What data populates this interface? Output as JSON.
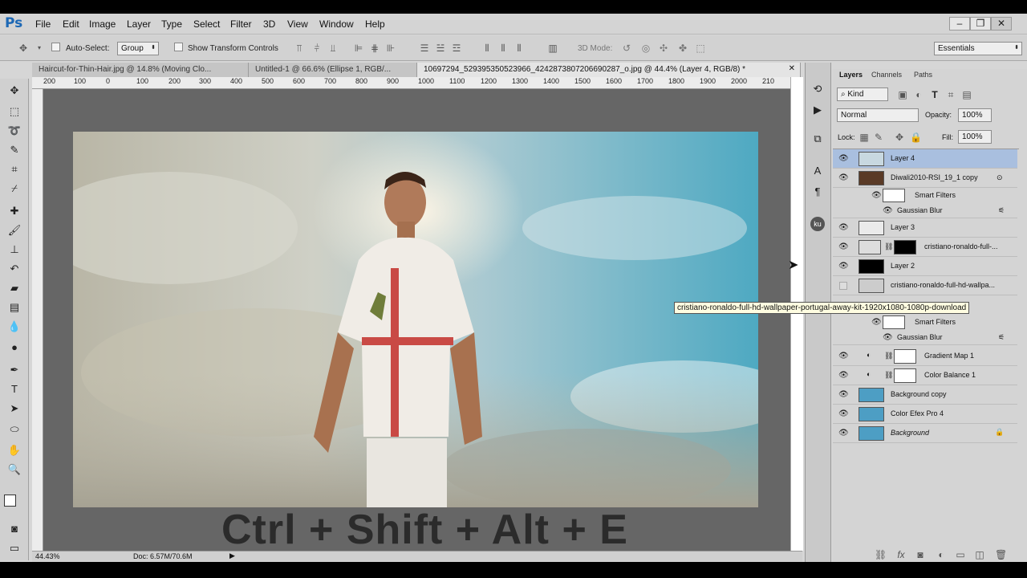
{
  "app": {
    "logo": "Ps"
  },
  "menu": [
    "File",
    "Edit",
    "Image",
    "Layer",
    "Type",
    "Select",
    "Filter",
    "3D",
    "View",
    "Window",
    "Help"
  ],
  "options": {
    "auto_select": "Auto-Select:",
    "auto_select_value": "Group",
    "show_transform": "Show Transform Controls",
    "mode_3d": "3D Mode:",
    "workspace": "Essentials"
  },
  "tabs": [
    "Haircut-for-Thin-Hair.jpg @ 14.8% (Moving Clo...",
    "Untitled-1 @ 66.6% (Ellipse 1, RGB/...",
    "10697294_529395350523966_4242873807206690287_o.jpg @ 44.4% (Layer 4, RGB/8) *"
  ],
  "ruler": [
    "200",
    "100",
    "0",
    "100",
    "200",
    "300",
    "400",
    "500",
    "600",
    "700",
    "800",
    "900",
    "1000",
    "1100",
    "1200",
    "1300",
    "1400",
    "1500",
    "1600",
    "1700",
    "1800",
    "1900",
    "2000",
    "210"
  ],
  "shortcut_text": "Ctrl + Shift + Alt + E",
  "status": {
    "zoom": "44.43%",
    "doc": "Doc: 6.57M/70.6M"
  },
  "layers_panel": {
    "tabs": [
      "Layers",
      "Channels",
      "Paths"
    ],
    "kind": "Kind",
    "blend": "Normal",
    "opacity_label": "Opacity:",
    "opacity": "100%",
    "lock_label": "Lock:",
    "fill_label": "Fill:",
    "fill": "100%",
    "layers": [
      {
        "name": "Layer 4",
        "visible": true
      },
      {
        "name": "Diwali2010-RSI_19_1 copy",
        "visible": true
      },
      {
        "name": "Smart Filters",
        "visible": true
      },
      {
        "name": "Gaussian Blur",
        "visible": true
      },
      {
        "name": "Layer 3",
        "visible": true
      },
      {
        "name": "cristiano-ronaldo-full-...",
        "visible": true
      },
      {
        "name": "Layer 2",
        "visible": true
      },
      {
        "name": "cristiano-ronaldo-full-hd-wallpa...",
        "visible": false
      },
      {
        "name": "Smart Filters",
        "visible": true
      },
      {
        "name": "Gaussian Blur",
        "visible": true
      },
      {
        "name": "Gradient Map 1",
        "visible": true
      },
      {
        "name": "Color Balance 1",
        "visible": true
      },
      {
        "name": "Background copy",
        "visible": true
      },
      {
        "name": "Color Efex Pro 4",
        "visible": true
      },
      {
        "name": "Background",
        "visible": true
      }
    ],
    "tooltip": "cristiano-ronaldo-full-hd-wallpaper-portugal-away-kit-1920x1080-1080p-download"
  }
}
